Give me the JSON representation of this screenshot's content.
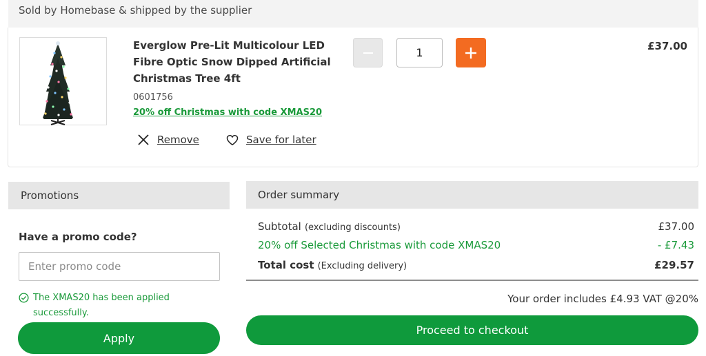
{
  "seller": {
    "text": "Sold by Homebase & shipped by the supplier"
  },
  "item": {
    "image_alt": "Christmas tree product image",
    "name": "Everglow Pre-Lit Multicolour LED Fibre Optic Snow Dipped Artificial Christmas Tree 4ft",
    "sku": "0601756",
    "promo_link": "20% off Christmas with code XMAS20",
    "remove_label": "Remove",
    "save_label": "Save for later",
    "quantity": "1",
    "price": "£37.00",
    "icons": {
      "minus": "minus-icon",
      "plus": "plus-icon",
      "remove": "close-icon",
      "save": "heart-icon"
    }
  },
  "promotions": {
    "header": "Promotions",
    "question": "Have a promo code?",
    "input_value": "",
    "input_placeholder": "Enter promo code",
    "success_message": "The XMAS20 has been applied successfully.",
    "apply_label": "Apply"
  },
  "summary": {
    "header": "Order summary",
    "subtotal_label": "Subtotal",
    "subtotal_note": "(excluding discounts)",
    "subtotal_value": "£37.00",
    "discount_label": "20% off Selected Christmas with code XMAS20",
    "discount_value": "- £7.43",
    "total_label": "Total cost",
    "total_note": "(Excluding delivery)",
    "total_value": "£29.57",
    "vat_text": "Your order includes £4.93 VAT @20%",
    "checkout_label": "Proceed to checkout"
  },
  "colors": {
    "accent_orange": "#f36b21",
    "brand_green": "#0f9a3c",
    "promo_green": "#1a9a3a",
    "panel_grey": "#e6e6e6"
  }
}
